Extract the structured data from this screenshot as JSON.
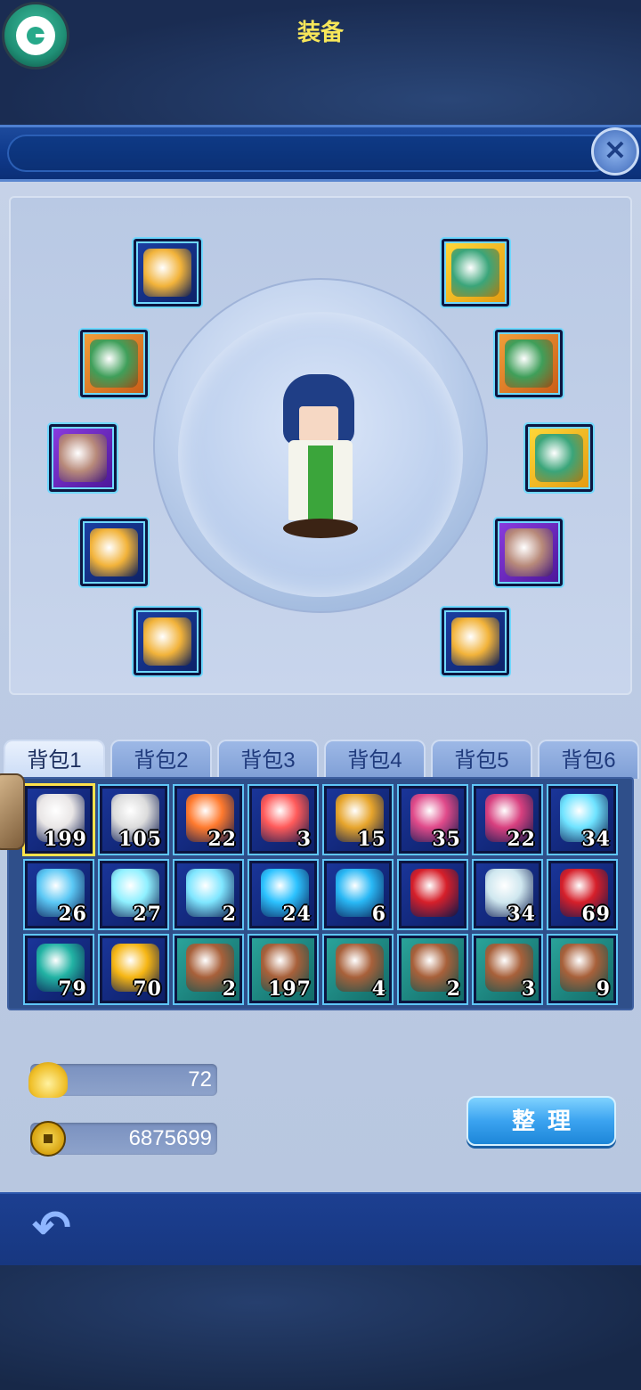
{
  "header": {
    "title": "装备",
    "close_icon": "close-icon"
  },
  "equipment": {
    "left_slots": [
      {
        "icon": "helmet-crown-icon",
        "bg": "blue"
      },
      {
        "icon": "green-jade-pendant-icon",
        "bg": "orange"
      },
      {
        "icon": "armor-robe-icon",
        "bg": "purple"
      },
      {
        "icon": "boots-icon",
        "bg": "blue"
      },
      {
        "icon": "blade-weapon-icon",
        "bg": "blue"
      }
    ],
    "right_slots": [
      {
        "icon": "talisman-charm-icon",
        "bg": "yellow"
      },
      {
        "icon": "white-cloak-icon",
        "bg": "orange"
      },
      {
        "icon": "jade-bracelet-icon",
        "bg": "yellow"
      },
      {
        "icon": "crystal-gem-icon",
        "bg": "purple"
      },
      {
        "icon": "yin-yang-orb-icon",
        "bg": "blue"
      }
    ]
  },
  "bag_tabs": [
    {
      "label": "背包1",
      "active": true
    },
    {
      "label": "背包2",
      "active": false
    },
    {
      "label": "背包3",
      "active": false
    },
    {
      "label": "背包4",
      "active": false
    },
    {
      "label": "背包5",
      "active": false
    },
    {
      "label": "背包6",
      "active": false
    }
  ],
  "bag_items": [
    {
      "icon": "white-potion-icon",
      "qty": "199",
      "color": "#e9e6e6",
      "selected": true
    },
    {
      "icon": "white-potion-icon",
      "qty": "105",
      "color": "#dcdcdc"
    },
    {
      "icon": "red-orange-potion-icon",
      "qty": "22",
      "color": "#ff7a2e"
    },
    {
      "icon": "red-potion-icon",
      "qty": "3",
      "color": "#ff5a5a"
    },
    {
      "icon": "gold-disc-icon",
      "qty": "15",
      "color": "#e7a52c"
    },
    {
      "icon": "pink-flask-icon",
      "qty": "35",
      "color": "#e04a8a"
    },
    {
      "icon": "pink-flask-icon",
      "qty": "22",
      "color": "#d8407f"
    },
    {
      "icon": "cyan-flask-icon",
      "qty": "34",
      "color": "#6fe3ff"
    },
    {
      "icon": "blue-round-flask-icon",
      "qty": "26",
      "color": "#5bc8f5"
    },
    {
      "icon": "cyan-bottle-icon",
      "qty": "27",
      "color": "#8ff0ff"
    },
    {
      "icon": "cyan-bottle-icon",
      "qty": "2",
      "color": "#7fe6ff"
    },
    {
      "icon": "blue-ring-orb-icon",
      "qty": "24",
      "color": "#2cc2ff"
    },
    {
      "icon": "blue-ring-orb-icon",
      "qty": "6",
      "color": "#29b8f5"
    },
    {
      "icon": "red-gem-book-icon",
      "qty": "",
      "color": "#d61f2a"
    },
    {
      "icon": "jar-icon",
      "qty": "34",
      "color": "#cfe7ef"
    },
    {
      "icon": "red-gem-book-icon",
      "qty": "69",
      "color": "#d61f2a"
    },
    {
      "icon": "teal-orb-book-icon",
      "qty": "79",
      "color": "#22b3a4"
    },
    {
      "icon": "gold-orb-icon",
      "qty": "70",
      "color": "#f6b614"
    },
    {
      "icon": "scroll-icon",
      "qty": "2",
      "color": "#a8603a",
      "scroll": true
    },
    {
      "icon": "scroll-icon",
      "qty": "197",
      "color": "#a8603a",
      "scroll": true
    },
    {
      "icon": "scroll-icon",
      "qty": "4",
      "color": "#a8603a",
      "scroll": true
    },
    {
      "icon": "scroll-icon",
      "qty": "2",
      "color": "#a8603a",
      "scroll": true
    },
    {
      "icon": "scroll-icon",
      "qty": "3",
      "color": "#a8603a",
      "scroll": true
    },
    {
      "icon": "scroll-icon",
      "qty": "9",
      "color": "#a8603a",
      "scroll": true
    }
  ],
  "currency": {
    "ingot": {
      "icon": "gold-ingot-icon",
      "value": "72"
    },
    "coins": {
      "icon": "copper-coin-icon",
      "value": "6875699"
    }
  },
  "sort_button": {
    "label": "整理"
  },
  "footer": {
    "back_icon": "back-arrow-icon"
  },
  "colors": {
    "title_text": "#f6e65a",
    "slot_border_glow": "#6fd8ff",
    "selected_highlight": "#ffe24a",
    "panel_bg": "#c7d3e8",
    "header_blue": "#0f3a8c"
  }
}
